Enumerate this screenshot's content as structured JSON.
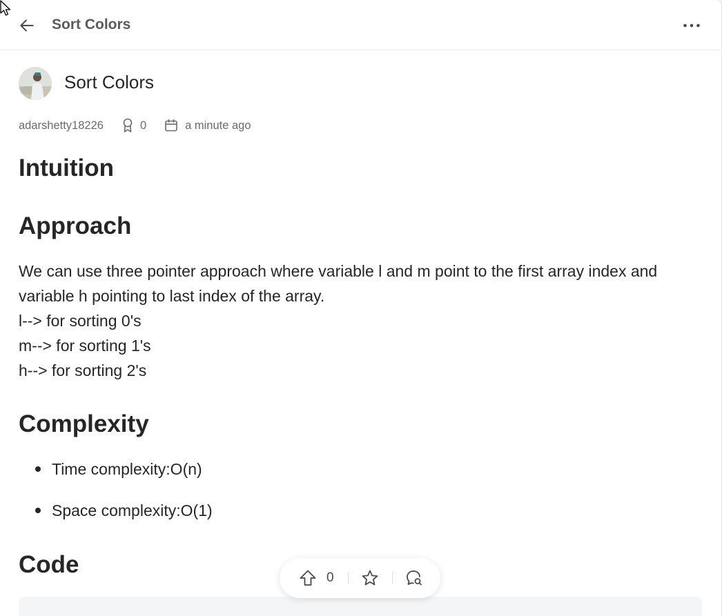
{
  "header": {
    "title": "Sort Colors",
    "back_icon": "arrow-left-icon",
    "more_icon": "more-horizontal-icon"
  },
  "post": {
    "title": "Sort Colors",
    "author": "adarshetty18226",
    "reputation": "0",
    "time": "a minute ago"
  },
  "article": {
    "intuition_heading": "Intuition",
    "approach_heading": "Approach",
    "approach_lines": [
      "We can use three pointer approach where variable l and m point to the first array index and",
      "variable h pointing to last index of the array.",
      "l--> for sorting 0's",
      "m--> for sorting 1's",
      "h--> for sorting 2's"
    ],
    "complexity_heading": "Complexity",
    "complexity_items": [
      "Time complexity:O(n)",
      "Space complexity:O(1)"
    ],
    "code_heading": "Code"
  },
  "actions": {
    "upvote_count": "0"
  },
  "colors": {
    "text": "#262626",
    "muted": "#6b6b6b",
    "code_bg": "#f4f5f7"
  }
}
